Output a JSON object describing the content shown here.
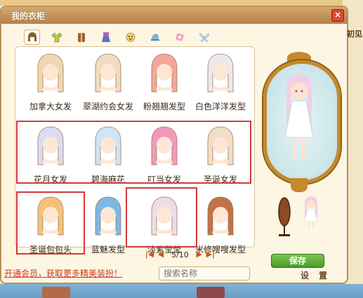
{
  "window": {
    "title": "我的衣柜",
    "side_text": "初见"
  },
  "tabs": [
    {
      "name": "hair-icon",
      "active": true
    },
    {
      "name": "shirt-icon",
      "active": false
    },
    {
      "name": "coat-icon",
      "active": false
    },
    {
      "name": "dress-icon",
      "active": false
    },
    {
      "name": "face-icon",
      "active": false
    },
    {
      "name": "hat-icon",
      "active": false
    },
    {
      "name": "accessory-icon",
      "active": false
    },
    {
      "name": "wings-icon",
      "active": false
    }
  ],
  "items": [
    {
      "label": "加拿大女发",
      "color": "#f1d7b0"
    },
    {
      "label": "翠湖约会女发",
      "color": "#f0dcc0"
    },
    {
      "label": "粉翘翘发型",
      "color": "#f3a79a"
    },
    {
      "label": "白色洋洋发型",
      "color": "#ede8ee"
    },
    {
      "label": "花月女发",
      "color": "#dcdcee"
    },
    {
      "label": "碧海麻花",
      "color": "#cfe4f5"
    },
    {
      "label": "叮当女发",
      "color": "#f19ab8"
    },
    {
      "label": "圣诞女发",
      "color": "#f1dec4"
    },
    {
      "label": "圣诞包包头",
      "color": "#f5c17b"
    },
    {
      "label": "蓝魅发型",
      "color": "#7fb6e6"
    },
    {
      "label": "淡紫莹莹",
      "color": "#eddce8"
    },
    {
      "label": "米修嗖嗖发型",
      "color": "#c1724a"
    }
  ],
  "pager": {
    "text": "5/10"
  },
  "footer": {
    "vip_link": "开通会员，获取更多精美装扮！",
    "search_placeholder": "搜索名称",
    "settings": "设置"
  },
  "save_label": "保存",
  "colors": {
    "accent_red": "#d23a3a",
    "title_bar": "#c08a4e",
    "save_green": "#5aae36"
  }
}
